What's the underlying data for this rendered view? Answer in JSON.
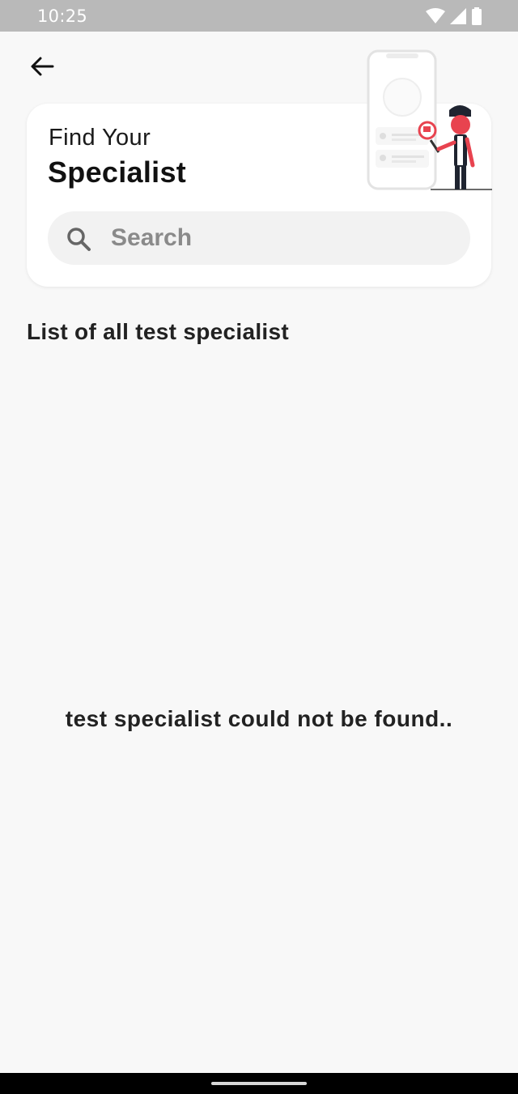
{
  "status_bar": {
    "time": "10:25",
    "icons": [
      "wifi-icon",
      "cell-signal-icon",
      "battery-icon"
    ]
  },
  "header": {
    "back_icon": "arrow-left-icon",
    "title_line1": "Find Your",
    "title_line2": "Specialist",
    "illustration": "phone-search-person-illustration"
  },
  "search": {
    "placeholder": "Search",
    "value": "",
    "icon": "search-icon"
  },
  "list": {
    "heading": "List of all test specialist",
    "items": [],
    "empty_message": "test specialist could not be found.."
  },
  "colors": {
    "background": "#f8f8f8",
    "card": "#ffffff",
    "status_bar": "#b9b9b9",
    "accent_red": "#e8434f",
    "text": "#1e1e1e"
  }
}
